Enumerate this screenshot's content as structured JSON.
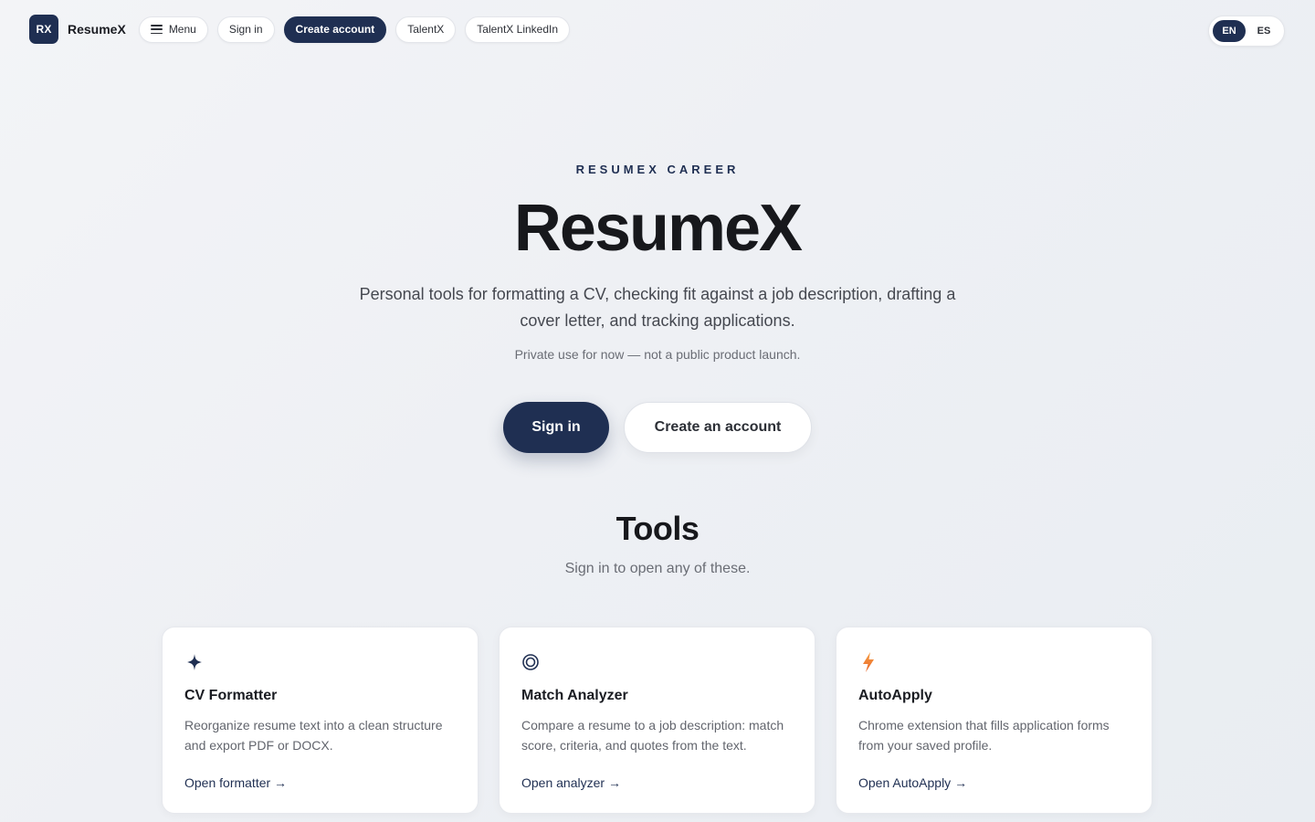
{
  "nav": {
    "logo_badge": "RX",
    "logo_text": "ResumeX",
    "menu_label": "Menu",
    "sign_in_label": "Sign in",
    "create_account_label": "Create account",
    "talentx_label": "TalentX",
    "talentx_linkedin_label": "TalentX LinkedIn"
  },
  "language": {
    "options": [
      "EN",
      "ES"
    ],
    "selected": "EN"
  },
  "hero": {
    "eyebrow": "RESUMEX CAREER",
    "title": "ResumeX",
    "description": "Personal tools for formatting a CV, checking fit against a job description, drafting a cover letter, and tracking applications.",
    "note": "Private use for now — not a public product launch.",
    "primary_cta": "Sign in",
    "secondary_cta": "Create an account"
  },
  "tools": {
    "title": "Tools",
    "subtitle": "Sign in to open any of these.",
    "items": [
      {
        "icon": "sparkle-icon",
        "title": "CV Formatter",
        "description": "Reorganize resume text into a clean structure and export PDF or DOCX.",
        "link": "Open formatter →"
      },
      {
        "icon": "target-icon",
        "title": "Match Analyzer",
        "description": "Compare a resume to a job description: match score, criteria, and quotes from the text.",
        "link": "Open analyzer →"
      },
      {
        "icon": "lightning-icon",
        "title": "AutoApply",
        "description": "Chrome extension that fills application forms from your saved profile.",
        "link": "Open AutoApply →"
      }
    ]
  },
  "colors": {
    "primary": "#1f2f52",
    "background": "#eef0f4",
    "accent_orange": "#f07a2a"
  }
}
